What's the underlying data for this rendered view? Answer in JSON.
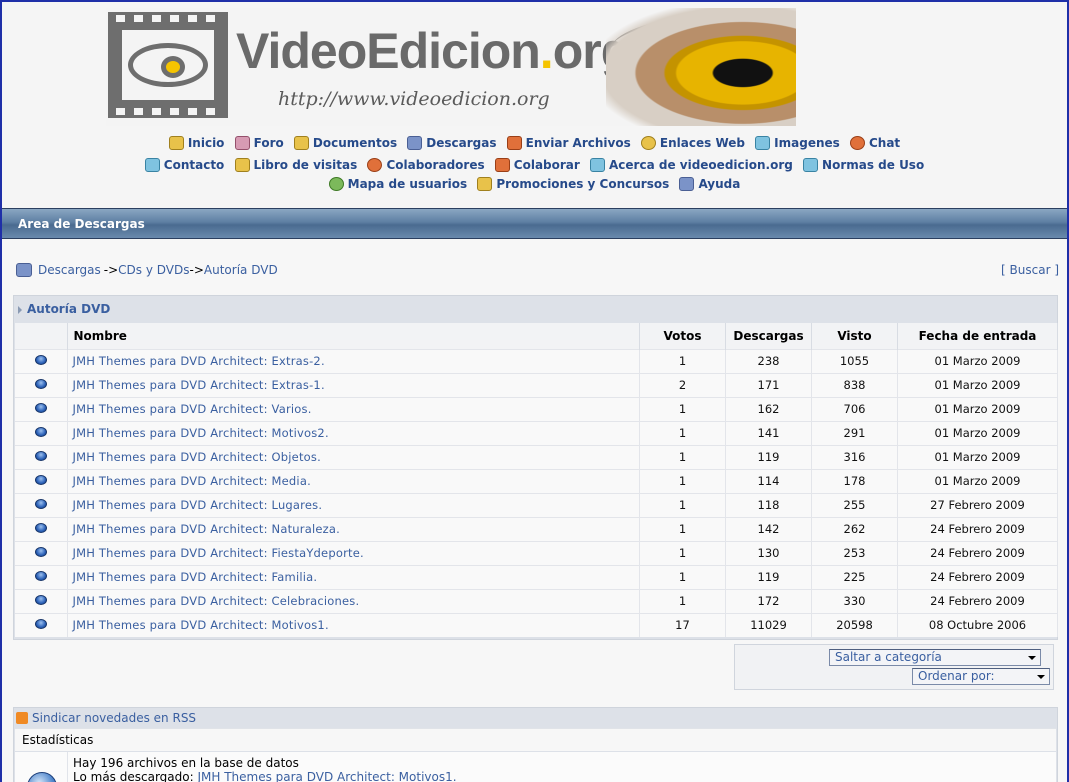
{
  "logo": {
    "brand_main": "VideoEdicion",
    "brand_dot": ".",
    "brand_tld": "org",
    "url": "http://www.videoedicion.org"
  },
  "nav": {
    "row1": [
      {
        "label": "Inicio",
        "icon": "home-icon"
      },
      {
        "label": "Foro",
        "icon": "forum-icon"
      },
      {
        "label": "Documentos",
        "icon": "documents-icon"
      },
      {
        "label": "Descargas",
        "icon": "floppy-disk-icon"
      },
      {
        "label": "Enviar Archivos",
        "icon": "send-files-icon"
      },
      {
        "label": "Enlaces Web",
        "icon": "globe-link-icon"
      },
      {
        "label": "Imagenes",
        "icon": "images-icon"
      },
      {
        "label": "Chat",
        "icon": "chat-user-icon"
      }
    ],
    "row2": [
      {
        "label": "Contacto",
        "icon": "contact-icon"
      },
      {
        "label": "Libro de visitas",
        "icon": "guestbook-icon"
      },
      {
        "label": "Colaboradores",
        "icon": "collaborators-icon"
      },
      {
        "label": "Colaborar",
        "icon": "collaborate-hand-icon"
      },
      {
        "label": "Acerca de videoedicion.org",
        "icon": "about-icon"
      },
      {
        "label": "Normas de Uso",
        "icon": "rules-icon"
      }
    ],
    "row3": [
      {
        "label": "Mapa de usuarios",
        "icon": "users-map-icon"
      },
      {
        "label": "Promociones y Concursos",
        "icon": "promotions-icon"
      },
      {
        "label": "Ayuda",
        "icon": "help-icon"
      }
    ]
  },
  "section_title": "Area de Descargas",
  "breadcrumb": {
    "root": "Descargas",
    "arrow1": "->",
    "cat": "CDs y DVDs",
    "arrow2": "->",
    "current": "Autoría DVD"
  },
  "search_link": "[ Buscar ]",
  "category": {
    "title": "Autoría DVD",
    "columns": {
      "name": "Nombre",
      "votes": "Votos",
      "downloads": "Descargas",
      "views": "Visto",
      "date": "Fecha de entrada"
    },
    "rows": [
      {
        "name": "JMH Themes para DVD Architect: Extras-2.",
        "votes": "1",
        "downloads": "238",
        "views": "1055",
        "date": "01 Marzo 2009"
      },
      {
        "name": "JMH Themes para DVD Architect: Extras-1.",
        "votes": "2",
        "downloads": "171",
        "views": "838",
        "date": "01 Marzo 2009"
      },
      {
        "name": "JMH Themes para DVD Architect: Varios.",
        "votes": "1",
        "downloads": "162",
        "views": "706",
        "date": "01 Marzo 2009"
      },
      {
        "name": "JMH Themes para DVD Architect: Motivos2.",
        "votes": "1",
        "downloads": "141",
        "views": "291",
        "date": "01 Marzo 2009"
      },
      {
        "name": "JMH Themes para DVD Architect: Objetos.",
        "votes": "1",
        "downloads": "119",
        "views": "316",
        "date": "01 Marzo 2009"
      },
      {
        "name": "JMH Themes para DVD Architect: Media.",
        "votes": "1",
        "downloads": "114",
        "views": "178",
        "date": "01 Marzo 2009"
      },
      {
        "name": "JMH Themes para DVD Architect: Lugares.",
        "votes": "1",
        "downloads": "118",
        "views": "255",
        "date": "27 Febrero 2009"
      },
      {
        "name": "JMH Themes para DVD Architect: Naturaleza.",
        "votes": "1",
        "downloads": "142",
        "views": "262",
        "date": "24 Febrero 2009"
      },
      {
        "name": "JMH Themes para DVD Architect: FiestaYdeporte.",
        "votes": "1",
        "downloads": "130",
        "views": "253",
        "date": "24 Febrero 2009"
      },
      {
        "name": "JMH Themes para DVD Architect: Familia.",
        "votes": "1",
        "downloads": "119",
        "views": "225",
        "date": "24 Febrero 2009"
      },
      {
        "name": "JMH Themes para DVD Architect: Celebraciones.",
        "votes": "1",
        "downloads": "172",
        "views": "330",
        "date": "24 Febrero 2009"
      },
      {
        "name": "JMH Themes para DVD Architect: Motivos1.",
        "votes": "17",
        "downloads": "11029",
        "views": "20598",
        "date": "08 Octubre 2006"
      }
    ]
  },
  "jump": {
    "category_select": "Saltar a categoría",
    "order_select": "Ordenar por:"
  },
  "stats": {
    "rss_label": "Sindicar novedades en RSS",
    "heading": "Estadísticas",
    "line1": "Hay 196 archivos en la base de datos",
    "line2_prefix": "Lo más descargado:",
    "line2_link": "JMH Themes para DVD Architect: Motivos1."
  },
  "colors": {
    "link": "#3a5fa0",
    "nav": "#264a8a",
    "titlebar": "#5e7fa3",
    "accent_yellow": "#f5c400"
  }
}
